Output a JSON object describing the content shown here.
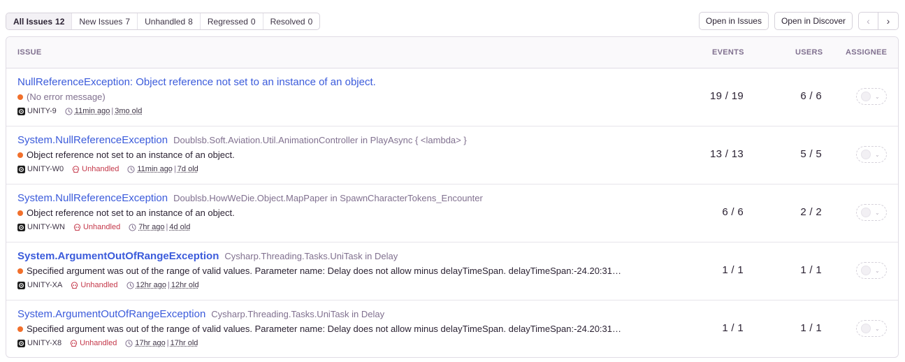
{
  "tabs": [
    {
      "label": "All Issues",
      "count": "12",
      "active": true
    },
    {
      "label": "New Issues",
      "count": "7"
    },
    {
      "label": "Unhandled",
      "count": "8"
    },
    {
      "label": "Regressed",
      "count": "0"
    },
    {
      "label": "Resolved",
      "count": "0"
    }
  ],
  "toolbar": {
    "open_in_issues": "Open in Issues",
    "open_in_discover": "Open in Discover",
    "prev": "‹",
    "next": "›"
  },
  "headers": {
    "issue": "ISSUE",
    "events": "EVENTS",
    "users": "USERS",
    "assignee": "ASSIGNEE"
  },
  "colors": {
    "accent": "#3b5bdb",
    "level_error": "#f1702c",
    "unhandled": "#c4384a"
  },
  "issues": [
    {
      "title": "NullReferenceException: Object reference not set to an instance of an object.",
      "culprit": "",
      "message": "(No error message)",
      "short_id": "UNITY-9",
      "unhandled": "",
      "last_seen": "11min ago",
      "first_seen": "3mo old",
      "events": "19 / 19",
      "users": "6 / 6"
    },
    {
      "title": "System.NullReferenceException",
      "culprit": "Doublsb.Soft.Aviation.Util.AnimationController in PlayAsync { <lambda> }",
      "message": "Object reference not set to an instance of an object.",
      "short_id": "UNITY-W0",
      "unhandled": "Unhandled",
      "last_seen": "11min ago",
      "first_seen": "7d old",
      "events": "13 / 13",
      "users": "5 / 5"
    },
    {
      "title": "System.NullReferenceException",
      "culprit": "Doublsb.HowWeDie.Object.MapPaper in SpawnCharacterTokens_Encounter",
      "message": "Object reference not set to an instance of an object.",
      "short_id": "UNITY-WN",
      "unhandled": "Unhandled",
      "last_seen": "7hr ago",
      "first_seen": "4d old",
      "events": "6 / 6",
      "users": "2 / 2"
    },
    {
      "title": "System.ArgumentOutOfRangeException",
      "culprit": "Cysharp.Threading.Tasks.UniTask in Delay",
      "message": "Specified argument was out of the range of valid values. Parameter name: Delay does not allow minus delayTimeSpan. delayTimeSpan:-24.20:31…",
      "short_id": "UNITY-XA",
      "unhandled": "Unhandled",
      "last_seen": "12hr ago",
      "first_seen": "12hr old",
      "events": "1 / 1",
      "users": "1 / 1"
    },
    {
      "title": "System.ArgumentOutOfRangeException",
      "culprit": "Cysharp.Threading.Tasks.UniTask in Delay",
      "message": "Specified argument was out of the range of valid values. Parameter name: Delay does not allow minus delayTimeSpan. delayTimeSpan:-24.20:31…",
      "short_id": "UNITY-X8",
      "unhandled": "Unhandled",
      "last_seen": "17hr ago",
      "first_seen": "17hr old",
      "events": "1 / 1",
      "users": "1 / 1"
    }
  ]
}
